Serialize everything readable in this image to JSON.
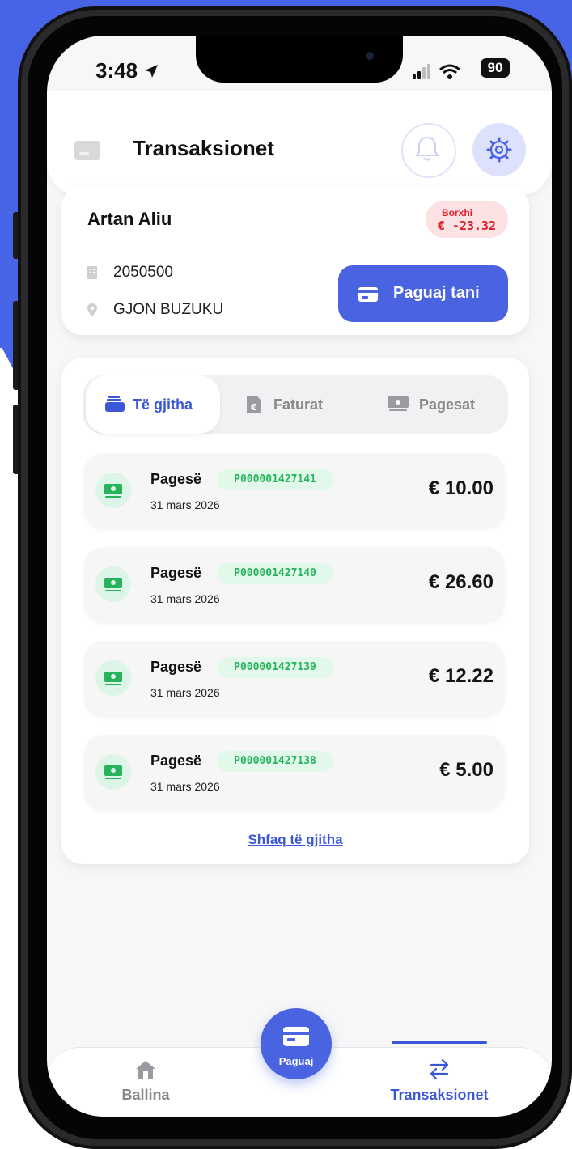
{
  "status_bar": {
    "time": "3:48",
    "battery": "90"
  },
  "header": {
    "title": "Transaksionet"
  },
  "account": {
    "name": "Artan Aliu",
    "debt_label": "Borxhi",
    "debt_value": "€ -23.32",
    "account_number": "2050500",
    "address": "GJON BUZUKU",
    "pay_button": "Paguaj tani"
  },
  "tabs": [
    {
      "label": "Të gjitha",
      "active": true
    },
    {
      "label": "Faturat",
      "active": false
    },
    {
      "label": "Pagesat",
      "active": false
    }
  ],
  "transactions": [
    {
      "title": "Pagesë",
      "ref": "P000001427141",
      "date": "31 mars 2026",
      "amount": "€ 10.00"
    },
    {
      "title": "Pagesë",
      "ref": "P000001427140",
      "date": "31 mars 2026",
      "amount": "€ 26.60"
    },
    {
      "title": "Pagesë",
      "ref": "P000001427139",
      "date": "31 mars 2026",
      "amount": "€ 12.22"
    },
    {
      "title": "Pagesë",
      "ref": "P000001427138",
      "date": "31 mars 2026",
      "amount": "€ 5.00"
    }
  ],
  "show_all": "Shfaq të gjitha",
  "bottom_nav": {
    "home": "Ballina",
    "pay": "Paguaj",
    "transactions": "Transaksionet"
  },
  "colors": {
    "accent": "#4a63e0",
    "debt": "#e0202b",
    "success": "#26b35c",
    "background_brand": "#4864e6"
  }
}
